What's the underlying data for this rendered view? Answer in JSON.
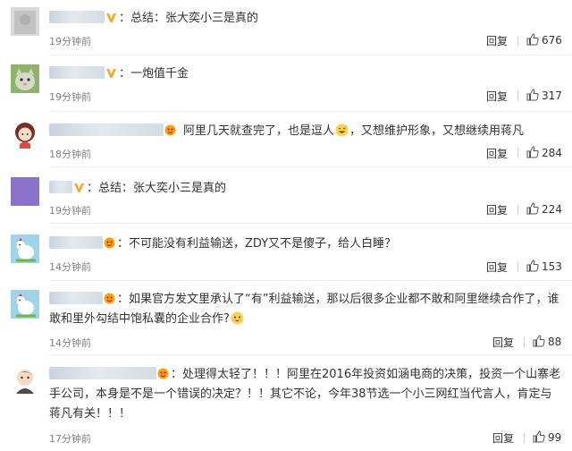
{
  "comments": [
    {
      "text": "总结：张大奕小三是真的",
      "time": "19分钟前",
      "reply_label": "回复",
      "likes": "676",
      "badge": "gold-v-icon",
      "avatar": "avatar-gray"
    },
    {
      "text": "一炮值千金",
      "time": "19分钟前",
      "reply_label": "回复",
      "likes": "317",
      "badge": "gold-v-icon",
      "avatar": "avatar-cat"
    },
    {
      "text_pre": "阿里几天就查完了，也是逗人",
      "text_post": "，又想维护形象，又想继续用蒋凡",
      "time": "18分钟前",
      "reply_label": "回复",
      "likes": "284",
      "badge": "vip-emoji-icon",
      "inline_emoji": "grin-sweat-emoji-icon",
      "avatar": "avatar-girl"
    },
    {
      "text": "总结：张大奕小三是真的",
      "time": "19分钟前",
      "reply_label": "回复",
      "likes": "224",
      "badge": "gold-v-icon",
      "avatar": "avatar-purple"
    },
    {
      "text": "不可能没有利益输送，ZDY又不是傻子，给人白睡？",
      "time": "14分钟前",
      "reply_label": "回复",
      "likes": "153",
      "badge": "vip-emoji-icon",
      "avatar": "avatar-chicken"
    },
    {
      "text_pre": "如果官方发文里承认了“有”利益输送，那以后很多企业都不敢和阿里继续合作了，谁敢和里外勾结中饱私囊的企业合作?",
      "time": "14分钟前",
      "reply_label": "回复",
      "likes": "88",
      "badge": "vip-emoji-icon",
      "inline_emoji": "cute-face-emoji-icon",
      "avatar": "avatar-chicken"
    },
    {
      "text": "处理得太轻了！！！阿里在2016年投资如涵电商的决策，投资一个山寨老手公司，本身是不是一个错误的决定？！！其它不论，今年38节选一个小三网红当代言人，肯定与蒋凡有关！！！",
      "time": "17分钟前",
      "reply_label": "回复",
      "likes": "99",
      "badge": "vip-emoji-icon",
      "avatar": "avatar-baby"
    }
  ],
  "colors": {
    "text": "#333333",
    "time": "#808080",
    "divider": "#eeeeee",
    "gold_v": "#f5a623"
  }
}
